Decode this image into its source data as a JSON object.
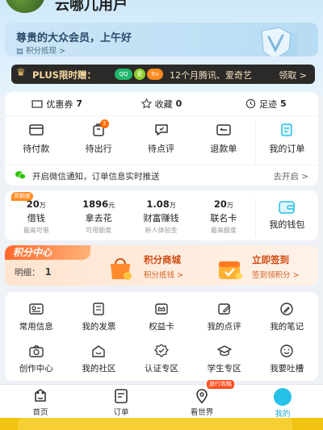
{
  "header": {
    "username": "云哪儿用户"
  },
  "member": {
    "greeting": "尊贵的大众会员，上午好",
    "points_link": "积分抵现 >"
  },
  "plus": {
    "title": "PLUS限时赠：",
    "logos": [
      "QQ",
      "爱",
      "ftv"
    ],
    "desc": "12个月腾讯、爱奇艺",
    "receive": "领取 >"
  },
  "stats": [
    {
      "icon": "ticket-icon",
      "label": "优惠券",
      "value": "7"
    },
    {
      "icon": "star-icon",
      "label": "收藏",
      "value": "0"
    },
    {
      "icon": "footprint-icon",
      "label": "足迹",
      "value": "5"
    }
  ],
  "orders": [
    {
      "icon": "wallet-icon",
      "label": "待付款",
      "badge": ""
    },
    {
      "icon": "luggage-icon",
      "label": "待出行",
      "badge": "3"
    },
    {
      "icon": "comment-icon",
      "label": "待点评",
      "badge": ""
    },
    {
      "icon": "refund-icon",
      "label": "退款单",
      "badge": ""
    },
    {
      "icon": "order-list-icon",
      "label": "我的订单",
      "badge": ""
    }
  ],
  "wechat_notice": {
    "text": "开启微信通知，订单信息实时推送",
    "action": "去开启 >"
  },
  "wallet": [
    {
      "badge": "高额度",
      "num": "20",
      "unit": "万",
      "label": "借钱",
      "sub": "最高可借"
    },
    {
      "badge": "",
      "num": "1896",
      "unit": "元",
      "label": "拿去花",
      "sub": "可用额度"
    },
    {
      "badge": "",
      "num": "1.08",
      "unit": "万",
      "label": "财富赚钱",
      "sub": "新人体验金"
    },
    {
      "badge": "",
      "num": "20",
      "unit": "万",
      "label": "联名卡",
      "sub": "最高额度"
    },
    {
      "badge": "",
      "num": "",
      "unit": "",
      "label": "我的钱包",
      "sub": ""
    }
  ],
  "points_center": {
    "title": "积分中心",
    "detail_label": "明细：",
    "detail_value": "1",
    "mall_title": "积分商城",
    "mall_sub": "积分抵钱 >",
    "checkin_title": "立即签到",
    "checkin_sub": "签到领积分 >"
  },
  "tools": [
    {
      "icon": "id-card-icon",
      "label": "常用信息"
    },
    {
      "icon": "invoice-icon",
      "label": "我的发票"
    },
    {
      "icon": "crown-card-icon",
      "label": "权益卡"
    },
    {
      "icon": "edit-icon",
      "label": "我的点评"
    },
    {
      "icon": "pen-icon",
      "label": "我的笔记"
    },
    {
      "icon": "camera-icon",
      "label": "创作中心"
    },
    {
      "icon": "community-icon",
      "label": "我的社区"
    },
    {
      "icon": "verified-icon",
      "label": "认证专区"
    },
    {
      "icon": "graduation-icon",
      "label": "学生专区"
    },
    {
      "icon": "smile-icon",
      "label": "我要吐槽"
    }
  ],
  "tabbar": [
    {
      "icon": "home-icon",
      "label": "首页",
      "tag": ""
    },
    {
      "icon": "orders-tab-icon",
      "label": "订单",
      "tag": ""
    },
    {
      "icon": "world-icon",
      "label": "看世界",
      "tag": "旅行攻略"
    },
    {
      "icon": "me-icon",
      "label": "我的",
      "tag": ""
    }
  ],
  "colors": {
    "accent": "#26c0e8",
    "orange": "#ff6a00",
    "plus_bg": "#2c2a28"
  }
}
